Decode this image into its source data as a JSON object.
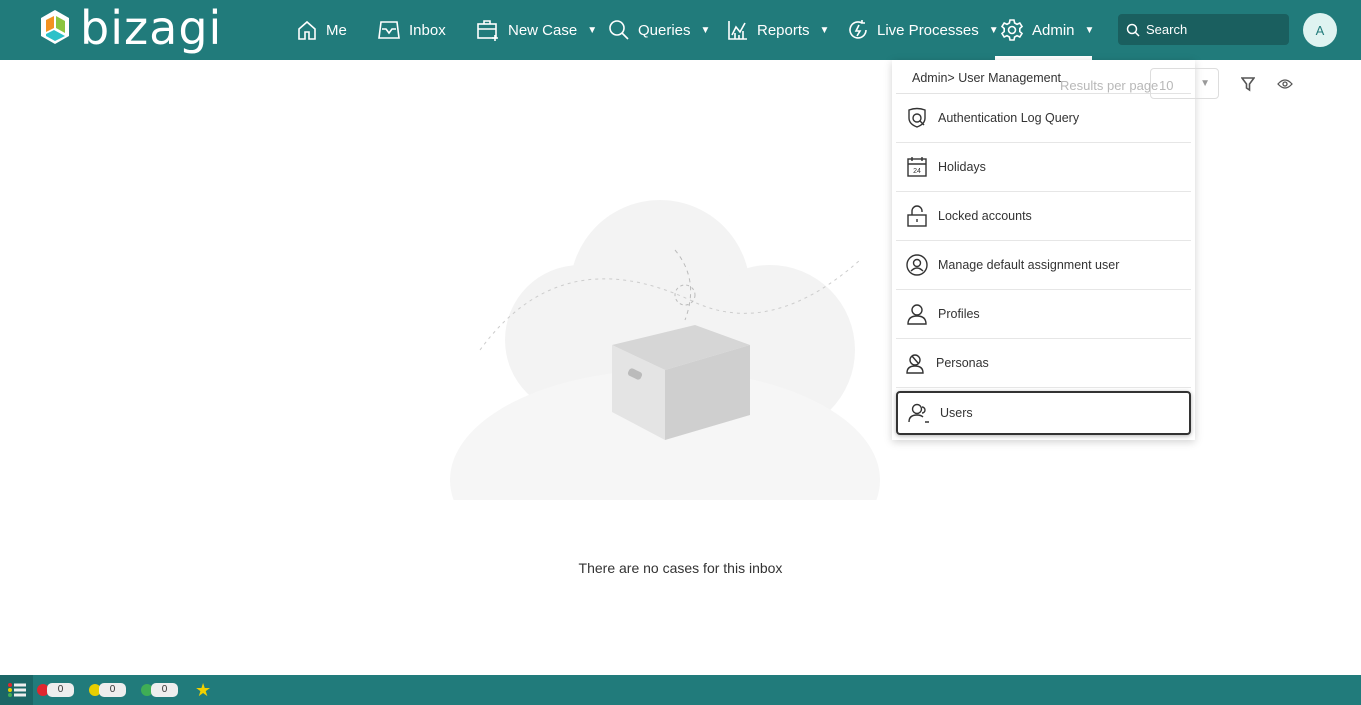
{
  "brand": {
    "name": "bizagi"
  },
  "nav": {
    "me": "Me",
    "inbox": "Inbox",
    "new_case": "New Case",
    "queries": "Queries",
    "reports": "Reports",
    "live_processes": "Live Processes",
    "admin": "Admin"
  },
  "search": {
    "placeholder": "Search"
  },
  "user": {
    "initial": "A"
  },
  "toolbar": {
    "results_per_page": "Results per page",
    "page_size": "10"
  },
  "admin_menu": {
    "breadcrumb": "Admin> User Management",
    "items": [
      {
        "label": "Authentication Log Query",
        "icon": "shield-search-icon"
      },
      {
        "label": "Holidays",
        "icon": "calendar-icon",
        "calendar_day": "24"
      },
      {
        "label": "Locked accounts",
        "icon": "lock-icon"
      },
      {
        "label": "Manage default assignment user",
        "icon": "user-circle-icon"
      },
      {
        "label": "Profiles",
        "icon": "user-icon"
      },
      {
        "label": "Personas",
        "icon": "personas-icon"
      },
      {
        "label": "Users",
        "icon": "users-icon",
        "selected": true
      }
    ]
  },
  "main": {
    "empty_message": "There are no cases for this inbox"
  },
  "footer": {
    "counters": [
      {
        "color": "#e0262f",
        "value": "0"
      },
      {
        "color": "#e8cf00",
        "value": "0"
      },
      {
        "color": "#3fae55",
        "value": "0"
      }
    ],
    "star_color": "#f2d100"
  },
  "colors": {
    "header": "#217b7b",
    "search_bg": "#1a5f5f"
  }
}
